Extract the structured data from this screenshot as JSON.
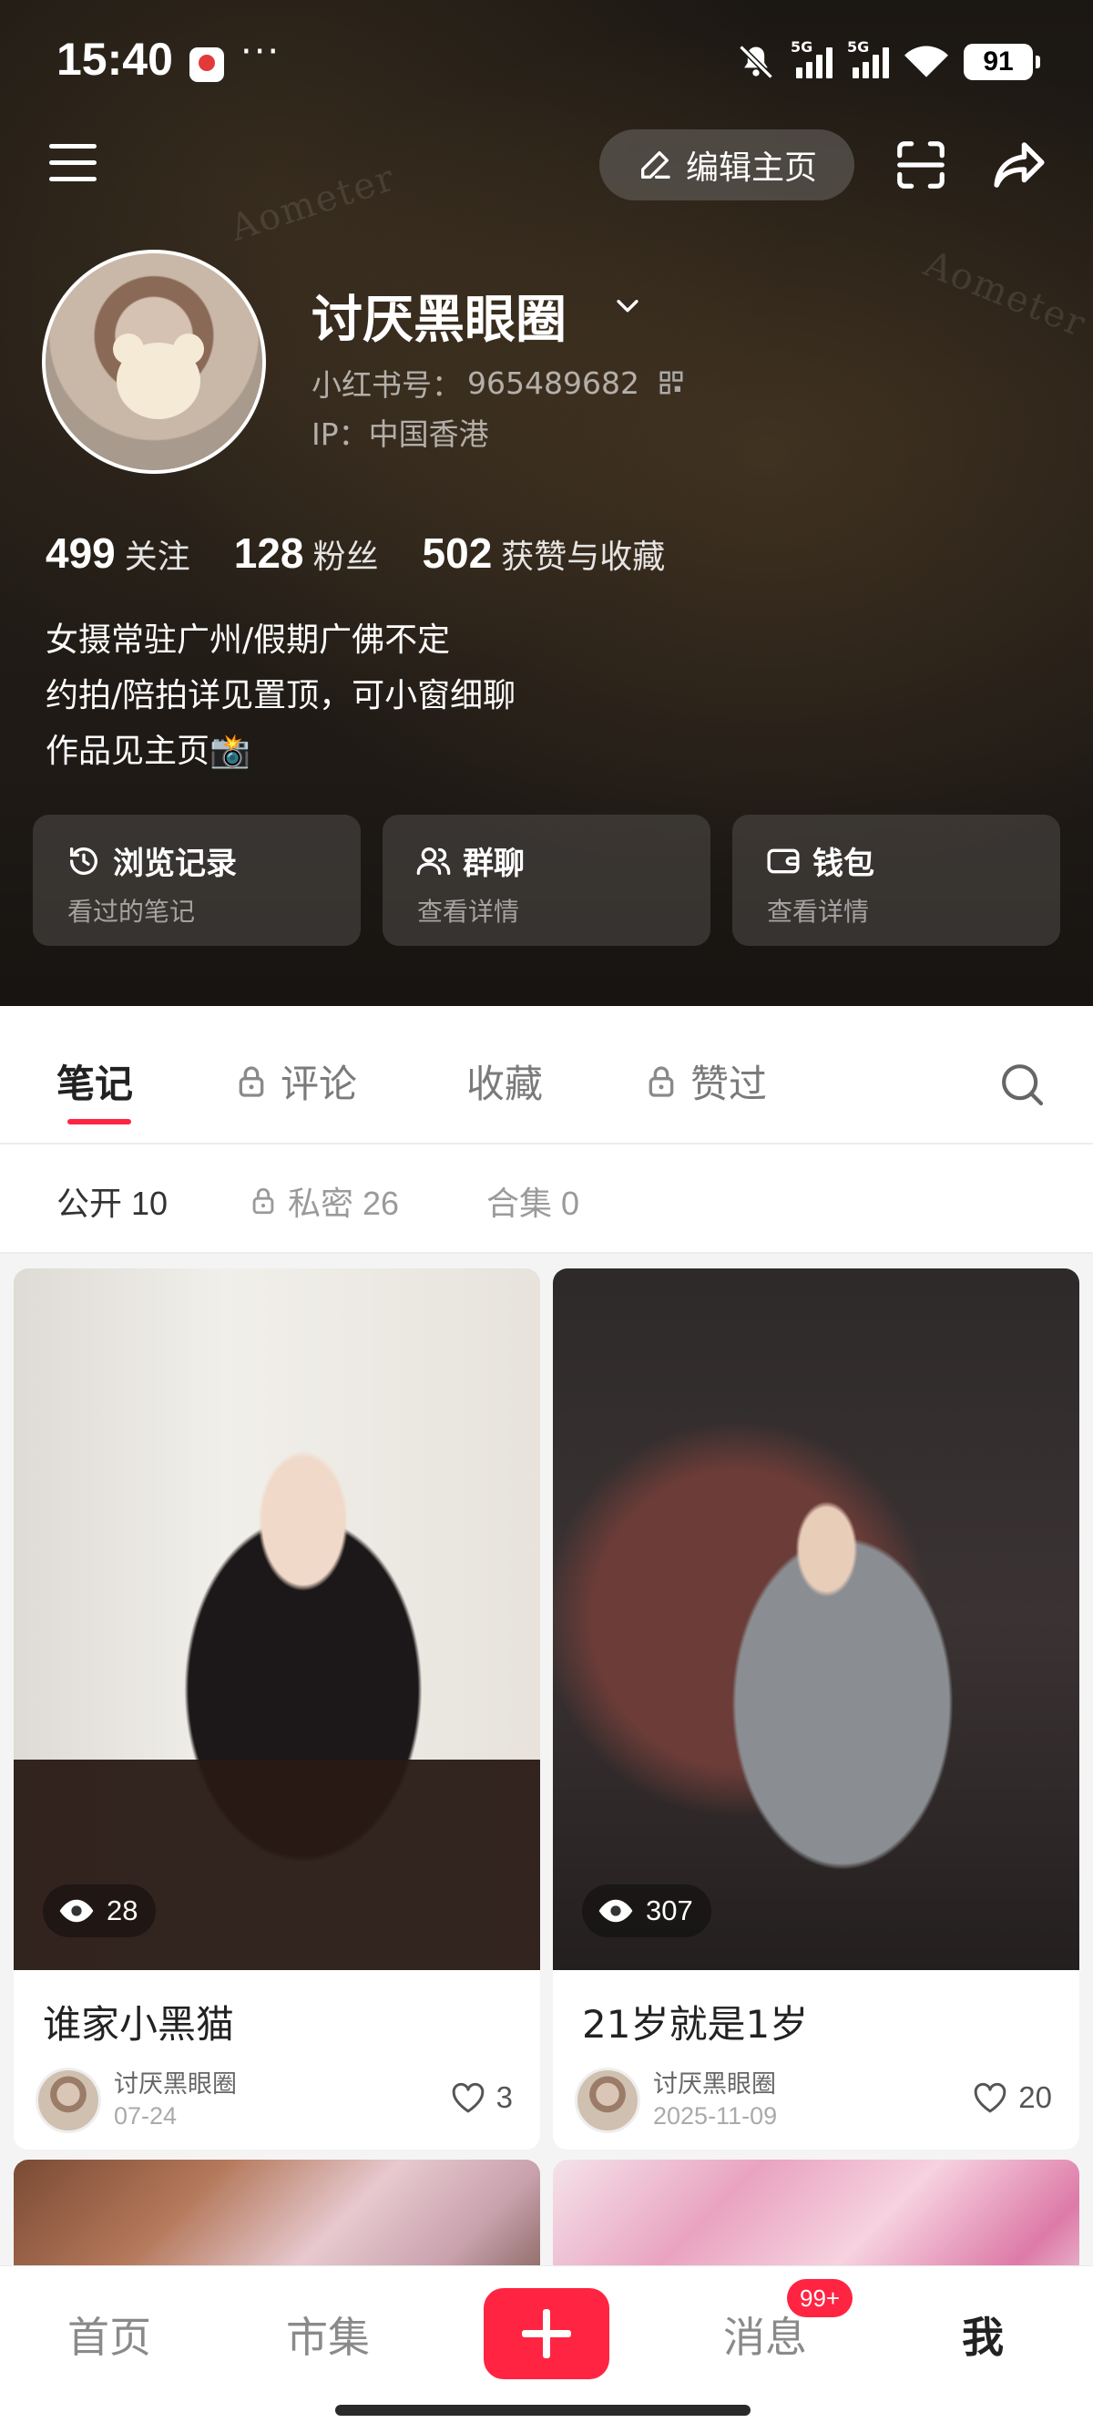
{
  "status_bar": {
    "time": "15:40",
    "more": "···",
    "network_1": "5G",
    "network_2": "5G",
    "battery": "91",
    "icons": [
      "app-notification-icon",
      "mute-bell-icon",
      "signal-icon",
      "wifi-icon",
      "battery-icon"
    ]
  },
  "top_bar": {
    "edit_profile_label": "编辑主页",
    "icons": [
      "menu-icon",
      "pencil-icon",
      "scan-icon",
      "share-icon"
    ]
  },
  "profile": {
    "nickname": "讨厌黑眼圈",
    "id_label": "小红书号：",
    "id_value": "965489682",
    "ip_line": "IP：中国香港",
    "stats": [
      {
        "value": "499",
        "label": "关注"
      },
      {
        "value": "128",
        "label": "粉丝"
      },
      {
        "value": "502",
        "label": "获赞与收藏"
      }
    ],
    "bio_lines": [
      "女摄常驻广州/假期广佛不定",
      "约拍/陪拍详见置顶，可小窗细聊",
      "作品见主页📸"
    ]
  },
  "quick_cards": [
    {
      "title": "浏览记录",
      "subtitle": "看过的笔记",
      "icon": "history-clock-icon"
    },
    {
      "title": "群聊",
      "subtitle": "查看详情",
      "icon": "group-chat-icon"
    },
    {
      "title": "钱包",
      "subtitle": "查看详情",
      "icon": "wallet-icon"
    }
  ],
  "tabs": [
    {
      "label": "笔记",
      "locked": false,
      "active": true
    },
    {
      "label": "评论",
      "locked": true,
      "active": false
    },
    {
      "label": "收藏",
      "locked": false,
      "active": false
    },
    {
      "label": "赞过",
      "locked": true,
      "active": false
    }
  ],
  "subtabs": [
    {
      "label": "公开 10",
      "locked": false,
      "active": true
    },
    {
      "label": "私密 26",
      "locked": true,
      "active": false
    },
    {
      "label": "合集 0",
      "locked": false,
      "active": false
    }
  ],
  "notes": [
    {
      "title": "谁家小黑猫",
      "views": "28",
      "author": "讨厌黑眼圈",
      "date": "07-24",
      "likes": "3"
    },
    {
      "title": "21岁就是1岁",
      "views": "307",
      "author": "讨厌黑眼圈",
      "date": "2025-11-09",
      "likes": "20"
    }
  ],
  "bottom_nav": {
    "items": [
      {
        "label": "首页",
        "active": false
      },
      {
        "label": "市集",
        "active": false
      },
      {
        "label": "消息",
        "active": false
      },
      {
        "label": "我",
        "active": true
      }
    ],
    "message_badge": "99+"
  },
  "colors": {
    "accent": "#ff2442",
    "header_bg": "#1f1a16"
  }
}
